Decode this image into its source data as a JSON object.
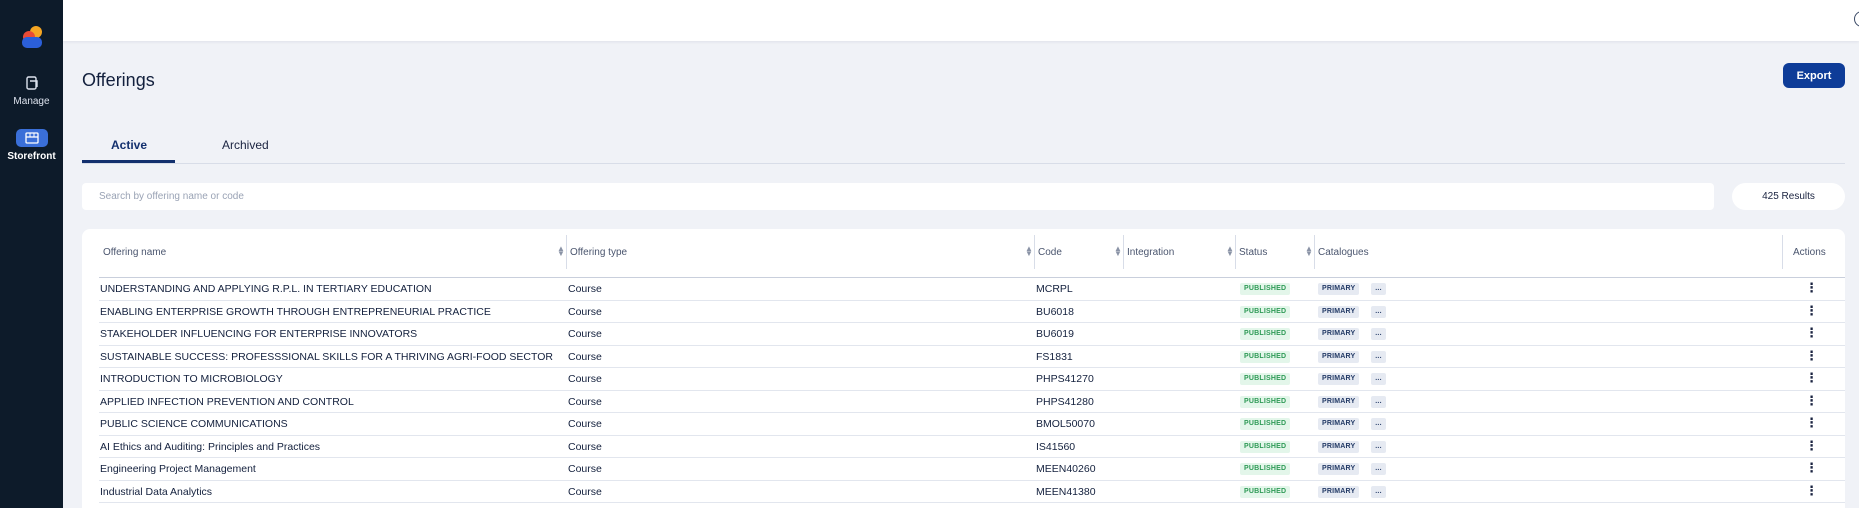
{
  "sidebar": {
    "items": [
      {
        "label": "Manage",
        "icon": "file-icon"
      },
      {
        "label": "Storefront",
        "icon": "storefront-icon",
        "active": true
      }
    ]
  },
  "topbar": {
    "help_icon": "?",
    "account_icon": "person-icon"
  },
  "page": {
    "title": "Offerings",
    "export_label": "Export"
  },
  "tabs": {
    "active": "Active",
    "archived": "Archived"
  },
  "search": {
    "placeholder": "Search by offering name or code",
    "value": "",
    "results": "425 Results"
  },
  "table": {
    "headers": {
      "name": "Offering name",
      "type": "Offering type",
      "code": "Code",
      "integration": "Integration",
      "status": "Status",
      "catalogues": "Catalogues",
      "actions": "Actions"
    },
    "rows": [
      {
        "name": "UNDERSTANDING AND APPLYING R.P.L. IN TERTIARY EDUCATION",
        "type": "Course",
        "code": "MCRPL",
        "status": "PUBLISHED",
        "catalogue": "PRIMARY",
        "more": "..."
      },
      {
        "name": "ENABLING ENTERPRISE GROWTH THROUGH ENTREPRENEURIAL PRACTICE",
        "type": "Course",
        "code": "BU6018",
        "status": "PUBLISHED",
        "catalogue": "PRIMARY",
        "more": "..."
      },
      {
        "name": "STAKEHOLDER INFLUENCING FOR ENTERPRISE INNOVATORS",
        "type": "Course",
        "code": "BU6019",
        "status": "PUBLISHED",
        "catalogue": "PRIMARY",
        "more": "..."
      },
      {
        "name": "SUSTAINABLE SUCCESS: PROFESSSIONAL SKILLS FOR A THRIVING AGRI-FOOD SECTOR",
        "type": "Course",
        "code": "FS1831",
        "status": "PUBLISHED",
        "catalogue": "PRIMARY",
        "more": "..."
      },
      {
        "name": "INTRODUCTION TO MICROBIOLOGY",
        "type": "Course",
        "code": "PHPS41270",
        "status": "PUBLISHED",
        "catalogue": "PRIMARY",
        "more": "..."
      },
      {
        "name": "APPLIED INFECTION PREVENTION AND CONTROL",
        "type": "Course",
        "code": "PHPS41280",
        "status": "PUBLISHED",
        "catalogue": "PRIMARY",
        "more": "..."
      },
      {
        "name": "PUBLIC SCIENCE COMMUNICATIONS",
        "type": "Course",
        "code": "BMOL50070",
        "status": "PUBLISHED",
        "catalogue": "PRIMARY",
        "more": "..."
      },
      {
        "name": "AI Ethics and Auditing: Principles and Practices",
        "type": "Course",
        "code": "IS41560",
        "status": "PUBLISHED",
        "catalogue": "PRIMARY",
        "more": "..."
      },
      {
        "name": "Engineering Project Management",
        "type": "Course",
        "code": "MEEN40260",
        "status": "PUBLISHED",
        "catalogue": "PRIMARY",
        "more": "..."
      },
      {
        "name": "Industrial Data Analytics",
        "type": "Course",
        "code": "MEEN41380",
        "status": "PUBLISHED",
        "catalogue": "PRIMARY",
        "more": "..."
      }
    ]
  },
  "colors": {
    "sidebar_bg": "#0d1b2a",
    "accent": "#0e3c98",
    "published_badge": "#2e9a56",
    "page_bg": "#f0f2f7"
  }
}
